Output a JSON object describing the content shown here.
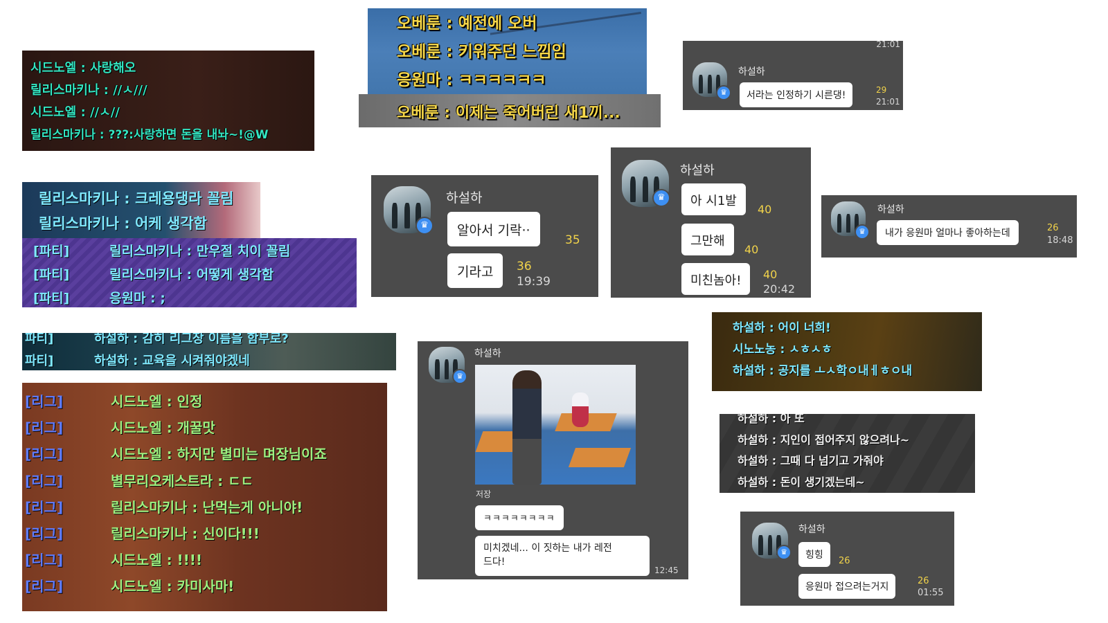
{
  "panel1": {
    "lines": [
      "시드노엘 : 사랑해오",
      "릴리스마키나 : //ㅅ///",
      "시드노엘 : //ㅅ//",
      "릴리스마키나 : ???:사랑하면 돈을 내놔~!@W"
    ]
  },
  "panel2": {
    "lines": [
      "오베룬 : 예전에 오버",
      "오베룬 : 키워주던 느낌임",
      "응원마 : ㅋㅋㅋㅋㅋㅋ",
      "오베룬 : 이제는 죽어버린 새1끼..."
    ]
  },
  "card1": {
    "name": "하설하",
    "top_time": "21:01",
    "message": "서라는 인정하기 시른댕!",
    "count": "29",
    "time": "21:01"
  },
  "panel3": {
    "lines": [
      "릴리스마키나 : 크레용댕라 꼴림",
      "릴리스마키나 : 어케 생각함"
    ],
    "party": [
      {
        "tag": "[파티]",
        "text": "릴리스마키나 : 만우절 치이 꼴림"
      },
      {
        "tag": "[파티]",
        "text": "릴리스마키나 : 어떻게 생각함"
      },
      {
        "tag": "[파티]",
        "text": "응원마 : ;"
      }
    ]
  },
  "card2": {
    "name": "하설하",
    "msg1": "알아서 기락··",
    "count1": "35",
    "msg2": "기라고",
    "count2": "36",
    "time": "19:39"
  },
  "card3": {
    "name": "하설하",
    "msg1": "아 시1발",
    "count1": "40",
    "msg2": "그만해",
    "count2": "40",
    "msg3": "미친놈아!",
    "count3": "40",
    "time": "20:42"
  },
  "card4": {
    "name": "하설하",
    "message": "내가 응원마 얼마나 좋아하는데",
    "count": "26",
    "time": "18:48"
  },
  "panel4": {
    "rows": [
      {
        "tag": "파티]",
        "text": "하설하 : 감히 리그장 이름을 함부로?"
      },
      {
        "tag": "파티]",
        "text": "하설하 : 교육을 시켜줘야겠네"
      }
    ]
  },
  "panel5": {
    "rows": [
      {
        "tag": "[리그]",
        "text": "시드노엘 : 인정"
      },
      {
        "tag": "[리그]",
        "text": "시드노엘 : 개꿀맛"
      },
      {
        "tag": "[리그]",
        "text": "시드노엘 : 하지만 별미는 며장님이죠"
      },
      {
        "tag": "[리그]",
        "text": "별무리오케스트라 : ㄷㄷ"
      },
      {
        "tag": "[리그]",
        "text": "릴리스마키나 : 난먹는게 아니야!"
      },
      {
        "tag": "[리그]",
        "text": "릴리스마키나 : 신이다!!!"
      },
      {
        "tag": "[리그]",
        "text": "시드노엘 : !!!!"
      },
      {
        "tag": "[리그]",
        "text": "시드노엘 : 카미사마!"
      }
    ]
  },
  "card5": {
    "name": "하설하",
    "image_label": "저장",
    "msg1": "ㅋㅋㅋㅋㅋㅋㅋㅋ",
    "msg2_line1": "미치겠네... 이 짓하는 내가 레전",
    "msg2_line2": "드다!",
    "time": "12:45"
  },
  "panel6": {
    "lines": [
      "하설하 : 어이 너희!",
      "시노노농 : ㅅㅎㅅㅎ",
      "하설하 : 공지를 ㅗㅅ학ㅇ내ㅔㅎㅇ내"
    ]
  },
  "panel7": {
    "lines": [
      "하설하 : 아 또",
      "하설하 : 지인이 접어주지 않으려나~",
      "하설하 : 그때 다 넘기고 가줘야",
      "하설하 : 돈이 생기겠는데~"
    ]
  },
  "card6": {
    "name": "하설하",
    "msg1": "힝힝",
    "count1": "26",
    "msg2": "응원마 접으려는거지",
    "count2": "26",
    "time": "01:55"
  }
}
